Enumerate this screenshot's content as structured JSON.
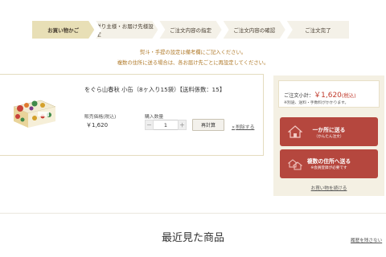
{
  "steps": [
    {
      "label": "お買い物かご",
      "active": true
    },
    {
      "label": "送り主様・お届け先様設定",
      "active": false
    },
    {
      "label": "ご注文内容の指定",
      "active": false
    },
    {
      "label": "ご注文内容の確認",
      "active": false
    },
    {
      "label": "ご注文完了",
      "active": false
    }
  ],
  "notices": [
    "熨斗・手提の設定は備考欄にご記入ください。",
    "複数の住所に送る場合は、各お届け先ごとに再設定してください。"
  ],
  "cart": {
    "product_title": "をぐら山春秋 小缶（8ヶ入り15袋）【送料係数：15】",
    "price_label": "販売価格(税込)",
    "price_value": "￥1,620",
    "quantity_label": "購入数量",
    "quantity_minus": "－",
    "quantity_value": "1",
    "quantity_plus": "＋",
    "recalc_label": "再計算",
    "delete_label": "削除する",
    "delete_icon": "×"
  },
  "summary": {
    "subtotal_label": "ご注文小計：",
    "subtotal_amount": "￥1,620",
    "subtotal_tax": "(税込)",
    "subtotal_note": "※別途、送料・手数料がかかります。",
    "one_address_main": "一か所に送る",
    "one_address_sub": "（かんたん注文）",
    "multi_address_main": "複数の住所へ送る",
    "multi_address_sub": "※会員登録が必要です",
    "continue_label": "お買い物を続ける",
    "accent_color": "#b5473e"
  },
  "recent": {
    "title": "最近見た商品",
    "history_link": "履歴を残さない"
  }
}
